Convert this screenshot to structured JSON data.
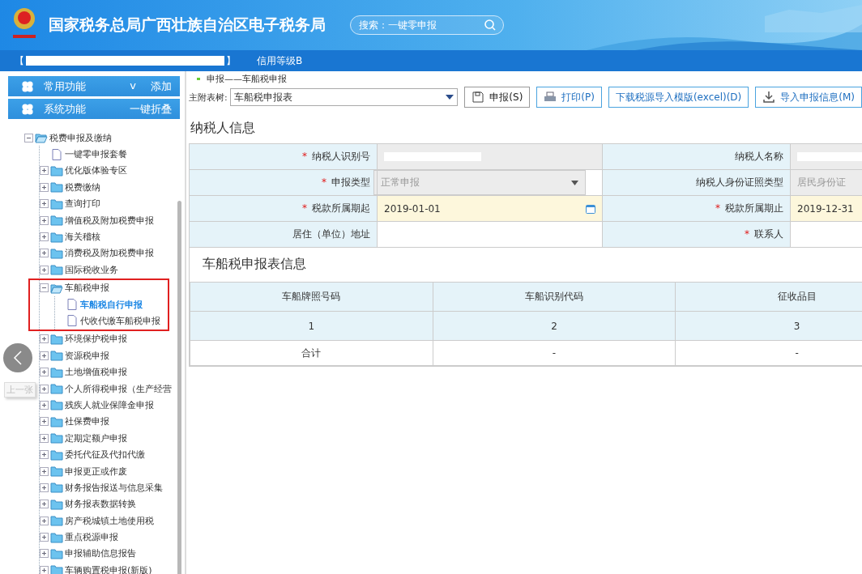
{
  "header": {
    "title": "国家税务总局广西壮族自治区电子税务局",
    "search_placeholder": "搜索：一键零申报"
  },
  "userbar": {
    "bracket_open": "【",
    "bracket_close": "】",
    "credit": "信用等级B"
  },
  "sidebar": {
    "panels": [
      {
        "label": "常用功能",
        "caret": "v",
        "action": "添加"
      },
      {
        "label": "系统功能",
        "action": "一键折叠"
      }
    ],
    "tree": [
      {
        "label": "税费申报及缴纳",
        "kind": "folder",
        "expanded": true,
        "children": [
          {
            "label": "一键零申报套餐",
            "kind": "file",
            "selected": false
          },
          {
            "label": "优化版体验专区",
            "kind": "folder",
            "expanded": false
          },
          {
            "label": "税费缴纳",
            "kind": "folder",
            "expanded": false
          },
          {
            "label": "查询打印",
            "kind": "folder",
            "expanded": false
          },
          {
            "label": "增值税及附加税费申报",
            "kind": "folder",
            "expanded": false
          },
          {
            "label": "海关稽核",
            "kind": "folder",
            "expanded": false
          },
          {
            "label": "消费税及附加税费申报",
            "kind": "folder",
            "expanded": false
          },
          {
            "label": "国际税收业务",
            "kind": "folder",
            "expanded": false
          },
          {
            "label": "车船税申报",
            "kind": "folder",
            "expanded": true,
            "highlighted": true,
            "children": [
              {
                "label": "车船税自行申报",
                "kind": "file",
                "selected": true
              },
              {
                "label": "代收代缴车船税申报",
                "kind": "file",
                "selected": false
              }
            ]
          },
          {
            "label": "环境保护税申报",
            "kind": "folder",
            "expanded": false
          },
          {
            "label": "资源税申报",
            "kind": "folder",
            "expanded": false
          },
          {
            "label": "土地增值税申报",
            "kind": "folder",
            "expanded": false
          },
          {
            "label": "个人所得税申报（生产经营",
            "kind": "folder",
            "expanded": false
          },
          {
            "label": "残疾人就业保障金申报",
            "kind": "folder",
            "expanded": false
          },
          {
            "label": "社保费申报",
            "kind": "folder",
            "expanded": false
          },
          {
            "label": "定期定额户申报",
            "kind": "folder",
            "expanded": false
          },
          {
            "label": "委托代征及代扣代缴",
            "kind": "folder",
            "expanded": false
          },
          {
            "label": "申报更正或作废",
            "kind": "folder",
            "expanded": false
          },
          {
            "label": "财务报告报送与信息采集",
            "kind": "folder",
            "expanded": false
          },
          {
            "label": "财务报表数据转换",
            "kind": "folder",
            "expanded": false
          },
          {
            "label": "房产税城镇土地使用税",
            "kind": "folder",
            "expanded": false
          },
          {
            "label": "重点税源申报",
            "kind": "folder",
            "expanded": false
          },
          {
            "label": "申报辅助信息报告",
            "kind": "folder",
            "expanded": false
          },
          {
            "label": "车辆购置税申报(新版)",
            "kind": "folder",
            "expanded": false
          }
        ]
      }
    ],
    "prev_tooltip": "上一张"
  },
  "main": {
    "breadcrumb": "申报——车船税申报",
    "form_tree": {
      "label": "主附表树:",
      "value": "车船税申报表"
    },
    "buttons": [
      {
        "label": "申报(S)",
        "kind": "save"
      },
      {
        "label": "打印(P)",
        "kind": "print"
      },
      {
        "label": "下载税源导入模版(excel)(D)",
        "kind": "plain"
      },
      {
        "label": "导入申报信息(M)",
        "kind": "import"
      }
    ],
    "taxpayer_title": "纳税人信息",
    "fields": [
      [
        {
          "label": "纳税人识别号",
          "required_mark": "*",
          "kind": "redacted"
        },
        {
          "label": "纳税人名称",
          "kind": "redacted"
        }
      ],
      [
        {
          "label": "申报类型",
          "required_mark": "*",
          "kind": "select",
          "value": "正常申报"
        },
        {
          "label": "纳税人身份证照类型",
          "kind": "readonly",
          "value": "居民身份证"
        }
      ],
      [
        {
          "label": "税款所属期起",
          "required_mark": "*",
          "kind": "date",
          "value": "2019-01-01",
          "picker": true
        },
        {
          "label": "税款所属期止",
          "required_mark": "*",
          "kind": "date",
          "value": "2019-12-31"
        }
      ],
      [
        {
          "label": "居住（单位）地址",
          "kind": "text"
        },
        {
          "label": "联系人",
          "required_mark": "*",
          "kind": "text"
        }
      ]
    ],
    "table_title": "车船税申报表信息",
    "table": {
      "columns": [
        "车船牌照号码",
        "车船识别代码",
        "征收品目"
      ],
      "rows": [
        {
          "kind": "index",
          "cells": [
            "1",
            "2",
            "3"
          ]
        },
        {
          "kind": "total",
          "cells": [
            "合计",
            "-",
            "-"
          ]
        }
      ]
    }
  }
}
